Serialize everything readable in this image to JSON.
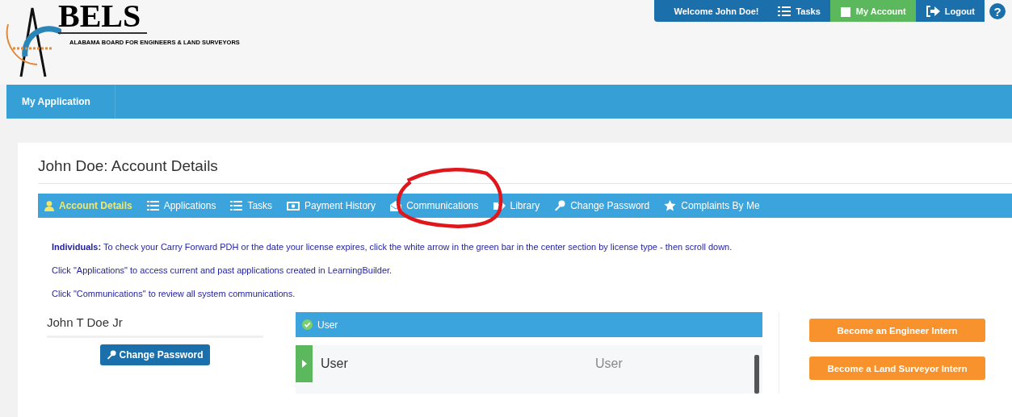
{
  "header": {
    "logo_text": "BELS",
    "org_name": "ALABAMA BOARD FOR ENGINEERS & LAND SURVEYORS",
    "top_menu": [
      {
        "kind": "text",
        "label": "Welcome John Doe!"
      },
      {
        "kind": "tasks",
        "label": "Tasks",
        "selected": false
      },
      {
        "kind": "account",
        "label": "My Account",
        "selected": true
      },
      {
        "kind": "logout",
        "label": "Logout",
        "selected": false
      }
    ],
    "help": "?"
  },
  "nav": {
    "items": [
      {
        "label": "My Application"
      }
    ]
  },
  "page": {
    "title": "John Doe: Account Details",
    "tabs": [
      {
        "kind": "user",
        "label": "Account Details",
        "selected": true
      },
      {
        "kind": "list",
        "label": "Applications",
        "selected": false
      },
      {
        "kind": "list",
        "label": "Tasks",
        "selected": false
      },
      {
        "kind": "money",
        "label": "Payment History",
        "selected": false
      },
      {
        "kind": "mail",
        "label": "Communications",
        "selected": false
      },
      {
        "kind": "library",
        "label": "Library",
        "selected": false
      },
      {
        "kind": "key",
        "label": "Change Password",
        "selected": false
      },
      {
        "kind": "star",
        "label": "Complaints By Me",
        "selected": false
      }
    ],
    "info": [
      "**Individuals:** To check your Carry Forward PDH or the date your license expires, click the white arrow in the green bar in the center section by license type - then scroll down.",
      "Click \"Applications\" to access current and past applications created in LearningBuilder.",
      "Click \"Communications\" to review all system communications."
    ]
  },
  "profile": {
    "name": "John T Doe Jr",
    "button": "Change Password"
  },
  "licenses": {
    "header": "User",
    "rows": [
      {
        "name": "User",
        "type": "User"
      }
    ]
  },
  "actions": [
    "Become an Engineer Intern",
    "Become a Land Surveyor Intern"
  ]
}
